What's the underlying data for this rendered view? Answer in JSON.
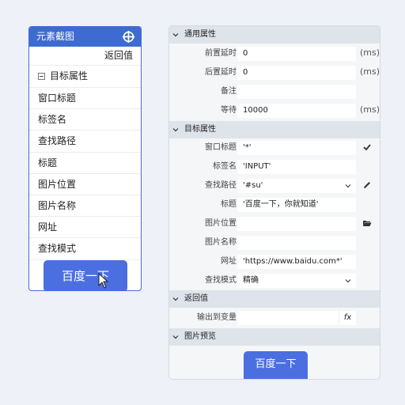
{
  "left_panel": {
    "title": "元素截图",
    "return_label": "返回值",
    "section_label": "目标属性",
    "items": [
      "窗口标题",
      "标签名",
      "查找路径",
      "标题",
      "图片位置",
      "图片名称",
      "网址",
      "查找模式"
    ],
    "button_label": "百度一下"
  },
  "right_panel": {
    "general": {
      "title": "通用属性",
      "pre_delay_label": "前置延时",
      "pre_delay_value": "0",
      "post_delay_label": "后置延时",
      "post_delay_value": "0",
      "note_label": "备注",
      "note_value": "",
      "wait_label": "等待",
      "wait_value": "10000",
      "unit": "(ms)"
    },
    "target": {
      "title": "目标属性",
      "window_title_label": "窗口标题",
      "window_title_value": "'*'",
      "tag_label": "标签名",
      "tag_value": "'INPUT'",
      "path_label": "查找路径",
      "path_value": "'#su'",
      "title_label": "标题",
      "title_value": "'百度一下，你就知道'",
      "image_pos_label": "图片位置",
      "image_pos_value": "",
      "image_name_label": "图片名称",
      "image_name_value": "",
      "url_label": "网址",
      "url_value": "'https://www.baidu.com*'",
      "mode_label": "查找模式",
      "mode_value": "精确"
    },
    "return_section": {
      "title": "返回值",
      "output_label": "输出到变量",
      "output_value": "",
      "fx_label": "fx"
    },
    "preview": {
      "title": "图片预览",
      "button_label": "百度一下"
    }
  },
  "colors": {
    "accent": "#3d6bd1",
    "button": "#4b6fe0",
    "section_bg": "#dfe3ea"
  }
}
